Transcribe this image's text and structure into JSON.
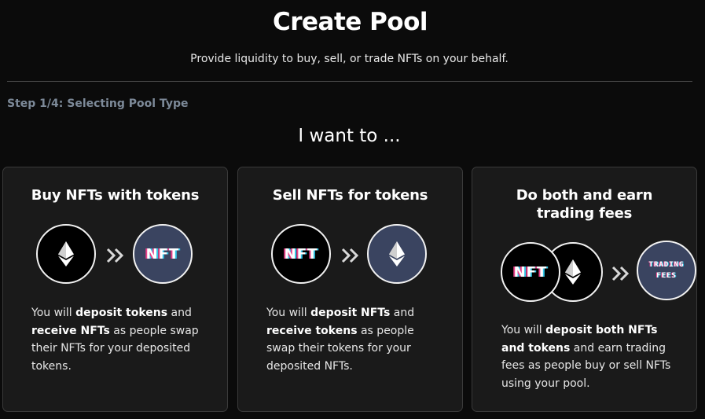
{
  "header": {
    "title": "Create Pool",
    "subtitle": "Provide liquidity to buy, sell, or trade NFTs on your behalf."
  },
  "step": {
    "label": "Step 1/4: Selecting Pool Type"
  },
  "prompt": "I want to ...",
  "cards": [
    {
      "title": "Buy NFTs with tokens",
      "from_icon": "eth-icon",
      "to_label": "NFT",
      "desc": {
        "p1": "You will ",
        "b1": "deposit tokens",
        "p2": " and ",
        "b2": "receive NFTs",
        "p3": " as people swap their NFTs for your deposited tokens."
      }
    },
    {
      "title": "Sell NFTs for tokens",
      "from_label": "NFT",
      "to_icon": "eth-icon",
      "desc": {
        "p1": "You will ",
        "b1": "deposit NFTs",
        "p2": " and ",
        "b2": "receive tokens",
        "p3": " as people swap their tokens for your deposited NFTs."
      }
    },
    {
      "title_line1": "Do both and earn",
      "title_line2": "trading fees",
      "from_label": "NFT",
      "to_label_line1": "TRADING",
      "to_label_line2": "FEES",
      "desc": {
        "p1": "You will ",
        "b1": "deposit both NFTs and tokens",
        "p2": " and earn trading fees as people buy or sell NFTs using your pool."
      }
    }
  ],
  "colors": {
    "background": "#0b0b0b",
    "card": "#1a1a1a",
    "card_border": "#3a3a3a",
    "step_text": "#7d8a99",
    "token_circle": "#3a4460",
    "nft_glitch_pink": "#e8418a",
    "nft_glitch_cyan": "#34c6e8"
  }
}
